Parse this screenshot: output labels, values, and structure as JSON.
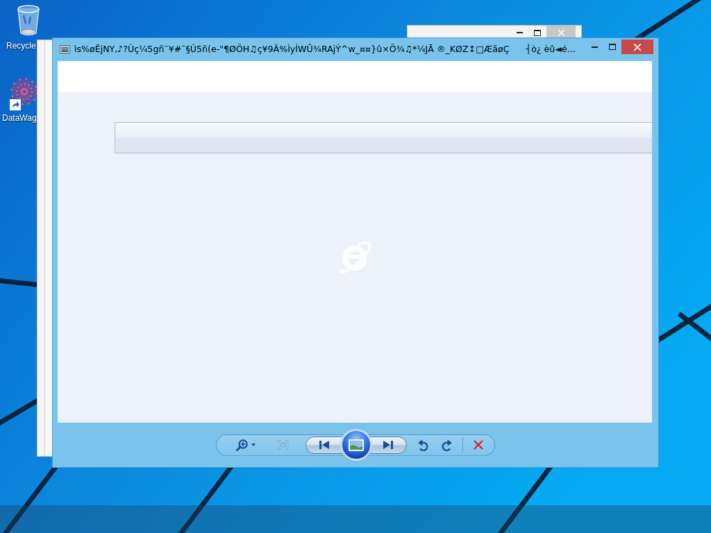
{
  "desktop": {
    "icons": [
      {
        "label": "Recycle",
        "shortcut": false
      },
      {
        "label": "DataWag",
        "shortcut": true
      }
    ]
  },
  "window": {
    "title": "ìs%øÊjNY,♪?Ùç¼5gñ¨¥#¯§Ú5ñ(e-\"¶ØÖH♫ç¥9Â%ÌyÍWÛ¾RAjÝ^w_¤¤}û×Ö¾♫*¼JĀ ®_KØZ↕□ÆãøÇ      ┤ò¿ èû◄é…"
  },
  "toolbar": {
    "buttons": [
      {
        "kind": "zoom",
        "disabled": false
      },
      {
        "kind": "fit",
        "disabled": true
      },
      {
        "kind": "previous",
        "disabled": false
      },
      {
        "kind": "slideshow",
        "disabled": false
      },
      {
        "kind": "next",
        "disabled": false
      },
      {
        "kind": "rotate-left",
        "disabled": false
      },
      {
        "kind": "rotate-right",
        "disabled": false
      },
      {
        "kind": "delete",
        "disabled": false
      }
    ]
  }
}
